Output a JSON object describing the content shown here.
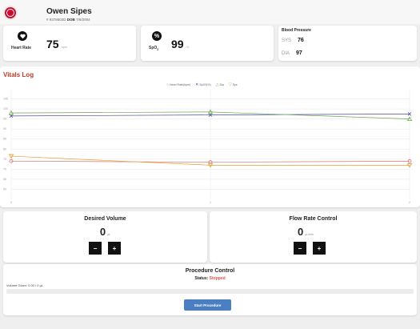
{
  "patient": {
    "name": "Owen Sipes",
    "id": "# 9378602D",
    "dob_label": "DOB",
    "dob": "7/6/2004"
  },
  "vitals": {
    "heart_rate": {
      "label": "Heart Rate",
      "value": "75",
      "unit": "bpm",
      "icon": "heart-icon"
    },
    "spo2": {
      "label": "SpO",
      "label_sub": "2",
      "value": "99",
      "unit": "%",
      "icon": "percent-icon"
    },
    "blood_pressure": {
      "title": "Blood Pressure",
      "sys_label": "SYS",
      "sys_value": "76",
      "dia_label": "DIA",
      "dia_value": "97"
    }
  },
  "vitals_log": {
    "title": "Vitals Log",
    "chart_data": {
      "type": "line",
      "x": [
        0,
        1,
        2
      ],
      "x_tick_labels": [
        "0",
        "1",
        "2"
      ],
      "ylim": [
        55,
        110
      ],
      "y_ticks": [
        60,
        65,
        70,
        75,
        80,
        85,
        90,
        95,
        100,
        105
      ],
      "grid": true,
      "legend_position": "top",
      "series": [
        {
          "name": "Heart Rate(bpm)",
          "values": [
            74,
            73.5,
            74
          ],
          "color": "#e07070",
          "marker": "circle"
        },
        {
          "name": "SpO2(%)",
          "values": [
            96.5,
            97,
            97.5
          ],
          "color": "#4a4aa8",
          "marker": "x"
        },
        {
          "name": "Dia",
          "values": [
            98,
            98.5,
            95
          ],
          "color": "#6aaa4a",
          "marker": "triangle-up"
        },
        {
          "name": "Sys",
          "values": [
            76.5,
            72,
            72
          ],
          "color": "#e0a030",
          "marker": "triangle-down"
        }
      ]
    }
  },
  "desired_volume": {
    "title": "Desired Volume",
    "value": "0",
    "unit": "µL",
    "minus": "−",
    "plus": "+"
  },
  "flow_rate": {
    "title": "Flow Rate Control",
    "value": "0",
    "unit": "µL/min",
    "minus": "−",
    "plus": "+"
  },
  "procedure": {
    "title": "Procedure Control",
    "status_label": "Status:",
    "status_value": "Stopped",
    "volume_given": "Volume Given: 0.00 / 0 µL",
    "progress": 0,
    "start_label": "Start Procedure"
  },
  "colors": {
    "accent": "#c0392b",
    "button_blue": "#4a7fc1",
    "logo_red": "#c8102e"
  }
}
